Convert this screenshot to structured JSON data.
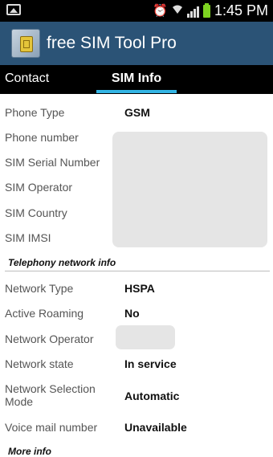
{
  "status_bar": {
    "time": "1:45 PM",
    "icons": [
      "image-icon",
      "alarm-icon",
      "wifi-icon",
      "signal-icon",
      "battery-icon"
    ]
  },
  "app": {
    "title": "free SIM Tool Pro"
  },
  "tabs": [
    {
      "label": "Contact",
      "selected": false
    },
    {
      "label": "SIM Info",
      "selected": true
    }
  ],
  "sim_info": {
    "rows": [
      {
        "label": "Phone Type",
        "value": "GSM"
      },
      {
        "label": "Phone number",
        "value": ""
      },
      {
        "label": "SIM Serial Number",
        "value": ""
      },
      {
        "label": "SIM Operator",
        "value": ""
      },
      {
        "label": "SIM Country",
        "value": ""
      },
      {
        "label": "SIM IMSI",
        "value": ""
      }
    ]
  },
  "telephony": {
    "header": "Telephony network info",
    "rows": [
      {
        "label": "Network Type",
        "value": "HSPA"
      },
      {
        "label": "Active Roaming",
        "value": "No"
      },
      {
        "label": "Network Operator",
        "value": ""
      },
      {
        "label": "Network state",
        "value": "In service"
      },
      {
        "label": "Network Selection Mode",
        "value": "Automatic"
      },
      {
        "label": "Voice mail number",
        "value": "Unavailable"
      }
    ]
  },
  "more_info": {
    "header": "More info"
  },
  "colors": {
    "status_bar": "#000000",
    "action_bar": "#2b5376",
    "tab_bar": "#000000",
    "tab_indicator": "#33b5e5",
    "battery": "#7ed321",
    "redaction": "#e5e5e5"
  }
}
